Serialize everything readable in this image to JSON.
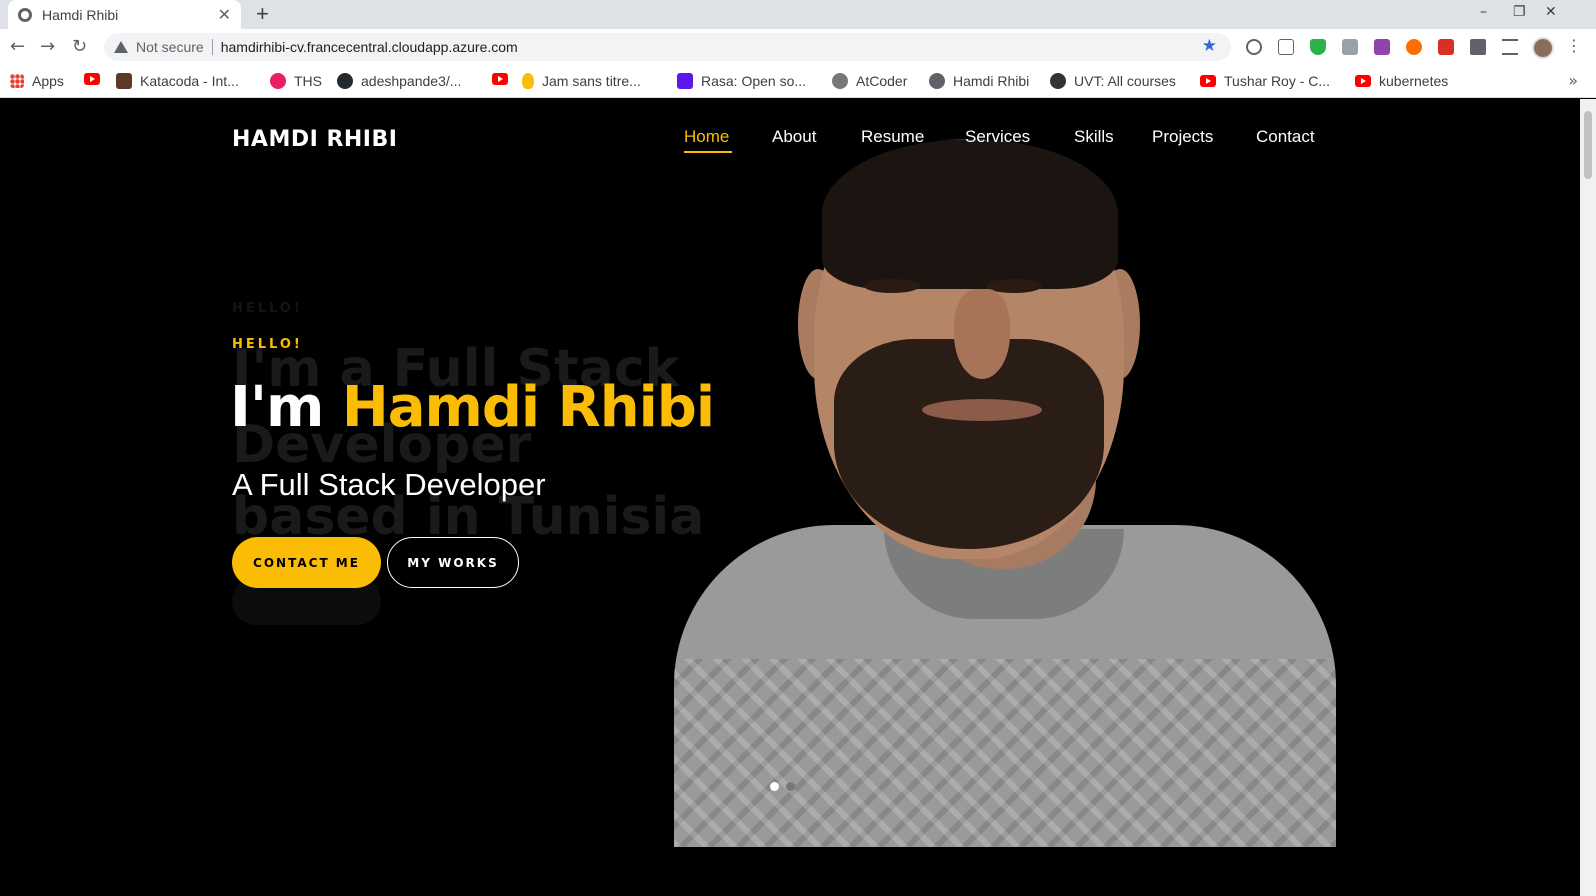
{
  "browser": {
    "tab_title": "Hamdi Rhibi",
    "new_tab": "+",
    "tab_close": "✕",
    "window": {
      "minimize": "–",
      "restore": "❐",
      "close": "✕"
    },
    "security_label": "Not secure",
    "url": "hamdirhibi-cv.francecentral.cloudapp.azure.com",
    "bookmarks": [
      {
        "label": "Apps",
        "icon": "apps-grid-icon"
      },
      {
        "label": "",
        "icon": "youtube-icon"
      },
      {
        "label": "Katacoda - Int...",
        "icon": "katacoda-icon"
      },
      {
        "label": "THS",
        "icon": "ths-icon"
      },
      {
        "label": "adeshpande3/...",
        "icon": "github-icon"
      },
      {
        "label": "",
        "icon": "youtube-icon"
      },
      {
        "label": "Jam sans titre...",
        "icon": "jam-icon"
      },
      {
        "label": "Rasa: Open so...",
        "icon": "rasa-icon"
      },
      {
        "label": "AtCoder",
        "icon": "atcoder-icon"
      },
      {
        "label": "Hamdi Rhibi",
        "icon": "globe-icon"
      },
      {
        "label": "UVT: All courses",
        "icon": "moodle-icon"
      },
      {
        "label": "Tushar Roy - C...",
        "icon": "youtube-icon"
      },
      {
        "label": "kubernetes",
        "icon": "youtube-icon"
      }
    ],
    "more": "»"
  },
  "site": {
    "brand": "HAMDI RHIBI",
    "nav": [
      "Home",
      "About",
      "Resume",
      "Services",
      "Skills",
      "Projects",
      "Contact"
    ],
    "active_nav": "Home",
    "hero": {
      "ghost_small": "HELLO!",
      "ghost_line1": "I'm a Full Stack",
      "ghost_line2": "Developer",
      "ghost_line3": "based in Tunisia",
      "hello": "HELLO!",
      "headline_prefix": "I'm ",
      "headline_name": "Hamdi Rhibi",
      "subtitle": "A Full Stack Developer",
      "contact_button": "CONTACT ME",
      "works_button": "MY WORKS"
    },
    "slider": {
      "slides": 2,
      "active": 1
    }
  },
  "colors": {
    "accent": "#fbbc05",
    "background": "#000000",
    "text": "#ffffff"
  }
}
